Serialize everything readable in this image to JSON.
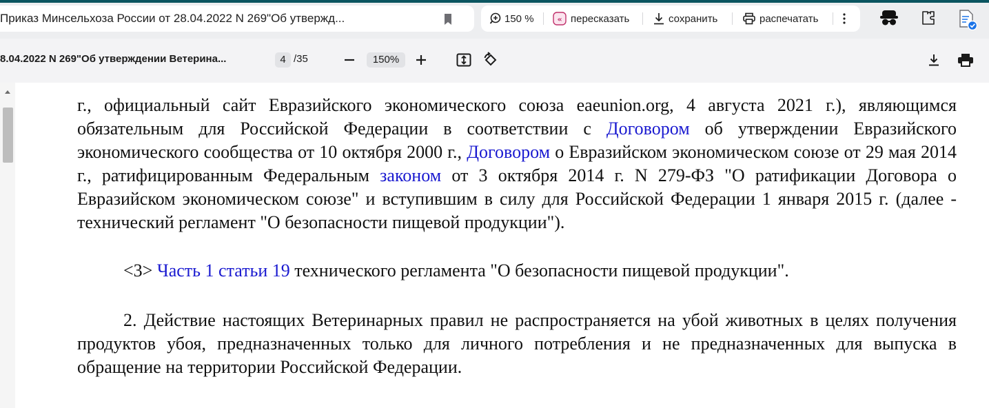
{
  "browser": {
    "tab_title": "Приказ Минсельхоза России от 28.04.2022 N 269\"Об утвержд...",
    "zoom_label": "150 %",
    "retell_label": "пересказать",
    "save_label": "сохранить",
    "print_label": "распечатать"
  },
  "pdf_viewer": {
    "doc_title": "8.04.2022 N 269\"Об утверждении Ветерина...",
    "current_page": "4",
    "total_pages": "/35",
    "zoom_value": "150%"
  },
  "document": {
    "p1_a": "г., официальный сайт Евразийского экономического союза eaeunion.org, 4 августа 2021 г.), являющимся обязательным для Российской Федерации в соответствии с ",
    "p1_link1": "Договором",
    "p1_b": " об утверждении Евразийского экономического сообщества от 10 октября 2000 г., ",
    "p1_link2": "Договором",
    "p1_c": " о Евразийском экономическом союзе от 29 мая 2014 г., ратифицированным Федеральным ",
    "p1_link3": "законом",
    "p1_d": " от 3 октября 2014 г. N 279-ФЗ \"О ратификации Договора о Евразийском экономическом союзе\" и вступившим в силу для Российской Федерации 1 января 2015 г. (далее - технический регламент \"О безопасности пищевой продукции\").",
    "fn3_marker": "<3> ",
    "fn3_link": "Часть 1 статьи 19",
    "fn3_text": " технического регламента \"О безопасности пищевой продукции\".",
    "p2": "2. Действие настоящих Ветеринарных правил не распространяется на убой животных в целях получения продуктов убоя, предназначенных только для личного потребления и не предназначенных для выпуска в обращение на территории Российской Федерации."
  },
  "colors": {
    "link": "#1a1ad0",
    "accent_teal": "#0b5560",
    "retell_icon": "#c0306b",
    "profile_badge": "#1a73e8"
  },
  "icons": [
    "bookmark-icon",
    "zoom-in-icon",
    "retell-icon",
    "download-icon",
    "print-icon",
    "more-icon",
    "incognito-icon",
    "extension-icon",
    "profile-icon",
    "zoom-out-icon",
    "zoom-plus-icon",
    "fit-page-icon",
    "rotate-icon",
    "pdf-download-icon",
    "pdf-print-icon",
    "scroll-up-icon"
  ]
}
